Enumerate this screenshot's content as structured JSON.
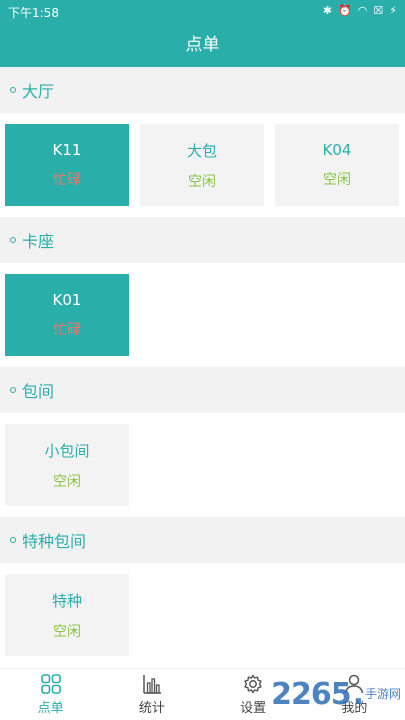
{
  "status_bar": {
    "time": "下午1:58",
    "icons": [
      "bluetooth-icon",
      "alarm-icon",
      "wifi-icon",
      "sim-icon",
      "charging-icon"
    ]
  },
  "header": {
    "title": "点单"
  },
  "sections": [
    {
      "title": "大厅",
      "tables": [
        {
          "name": "K11",
          "status": "忙碌",
          "selected": true
        },
        {
          "name": "大包",
          "status": "空闲",
          "selected": false
        },
        {
          "name": "K04",
          "status": "空闲",
          "selected": false
        }
      ]
    },
    {
      "title": "卡座",
      "tables": [
        {
          "name": "K01",
          "status": "忙碌",
          "selected": true
        }
      ]
    },
    {
      "title": "包间",
      "tables": [
        {
          "name": "小包间",
          "status": "空闲",
          "selected": false
        }
      ]
    },
    {
      "title": "特种包间",
      "tables": [
        {
          "name": "特种",
          "status": "空闲",
          "selected": false
        }
      ]
    }
  ],
  "tabbar": {
    "items": [
      {
        "label": "点单",
        "icon": "grid-icon",
        "active": true
      },
      {
        "label": "统计",
        "icon": "bar-chart-icon",
        "active": false
      },
      {
        "label": "设置",
        "icon": "gear-icon",
        "active": false
      },
      {
        "label": "我的",
        "icon": "user-icon",
        "active": false
      }
    ]
  },
  "watermark": {
    "number": "2265",
    "dot": ".",
    "text": "手游网"
  },
  "colors": {
    "accent": "#2aaeaa",
    "busy": "#e57a6b",
    "free": "#8bc34a",
    "card_bg": "#f3f3f3"
  }
}
